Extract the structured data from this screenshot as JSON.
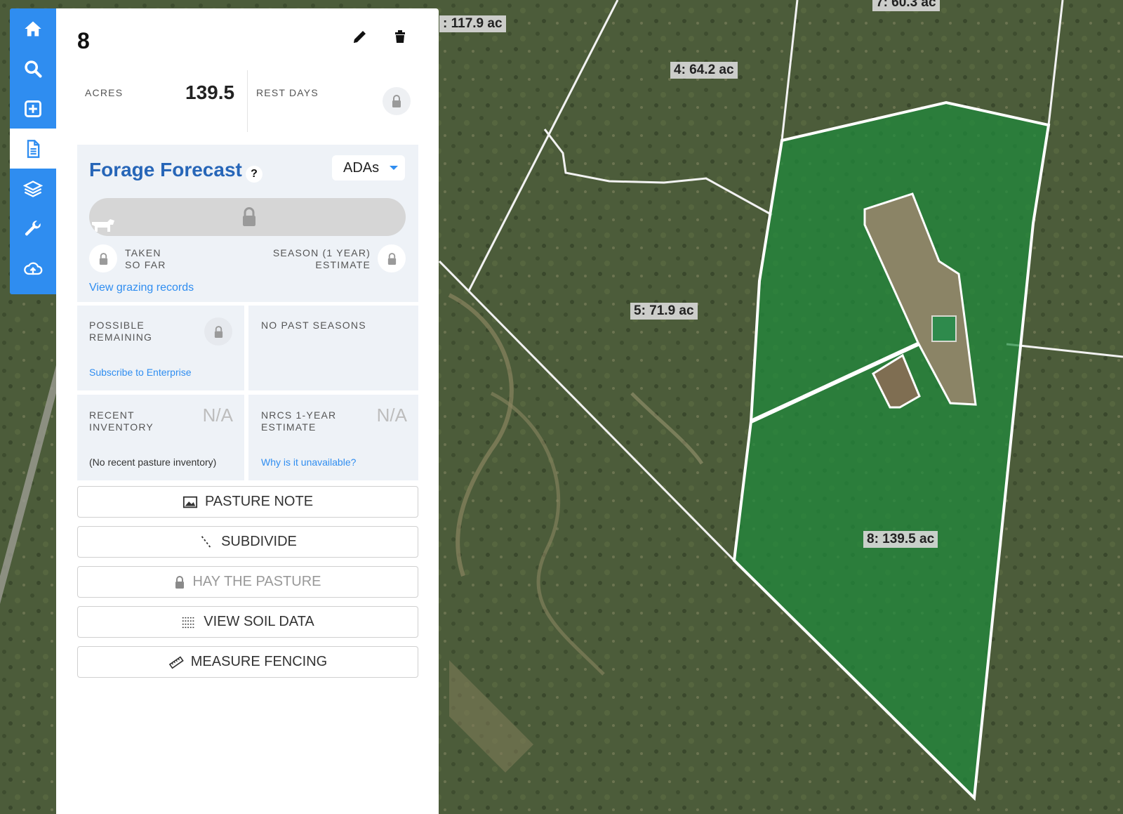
{
  "map": {
    "labels": [
      {
        "id": "label-117",
        "text": ": 117.9 ac"
      },
      {
        "id": "label-7",
        "text": "7: 60.3 ac"
      },
      {
        "id": "label-4",
        "text": "4: 64.2 ac"
      },
      {
        "id": "label-5",
        "text": "5: 71.9 ac"
      },
      {
        "id": "label-8",
        "text": "8: 139.5 ac"
      }
    ]
  },
  "rail": {
    "items": [
      {
        "icon": "home-icon",
        "active": false
      },
      {
        "icon": "search-icon",
        "active": false
      },
      {
        "icon": "add-square-icon",
        "active": false
      },
      {
        "icon": "document-icon",
        "active": true
      },
      {
        "icon": "layers-icon",
        "active": false
      },
      {
        "icon": "wrench-icon",
        "active": false
      },
      {
        "icon": "cloud-upload-icon",
        "active": false
      }
    ]
  },
  "panel": {
    "title": "8",
    "acres_label": "ACRES",
    "acres_value": "139.5",
    "rest_days_label": "REST DAYS",
    "forage": {
      "title": "Forage Forecast",
      "help": "?",
      "unit": "ADAs",
      "taken_label_1": "TAKEN",
      "taken_label_2": "SO FAR",
      "season_label_1": "SEASON (1 YEAR)",
      "season_label_2": "ESTIMATE",
      "grazing_link": "View grazing records"
    },
    "possible": {
      "label_1": "POSSIBLE",
      "label_2": "REMAINING",
      "link": "Subscribe to Enterprise"
    },
    "past_seasons": "NO PAST SEASONS",
    "recent_inventory": {
      "label_1": "RECENT",
      "label_2": "INVENTORY",
      "value": "N/A",
      "note": "(No recent pasture inventory)"
    },
    "nrcs": {
      "label_1": "NRCS 1-YEAR",
      "label_2": "ESTIMATE",
      "value": "N/A",
      "link": "Why is it unavailable?"
    },
    "actions": {
      "pasture_note": "PASTURE NOTE",
      "subdivide": "SUBDIVIDE",
      "hay": "HAY THE PASTURE",
      "soil": "VIEW SOIL DATA",
      "fencing": "MEASURE FENCING"
    }
  },
  "colors": {
    "accent": "#2f8df0",
    "title_blue": "#2766b8",
    "selected_pasture": "#1f8a3c"
  }
}
